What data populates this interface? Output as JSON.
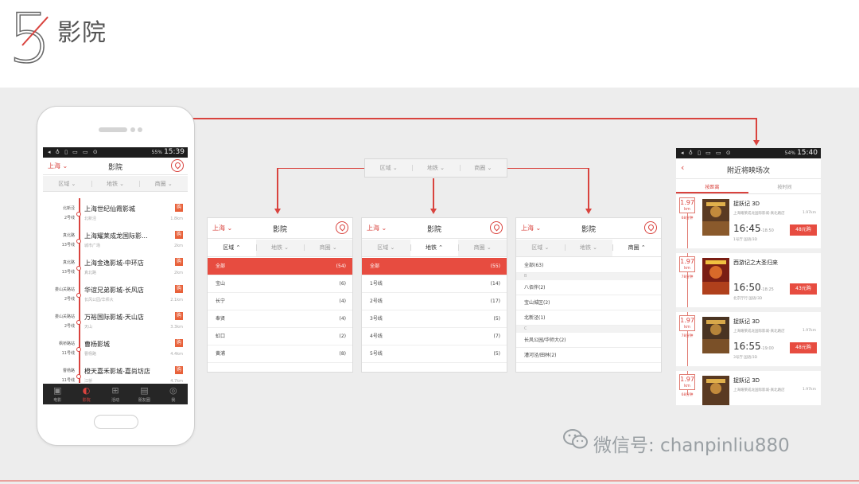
{
  "header": {
    "number": "5",
    "title": "影院"
  },
  "status": {
    "time1": "15:39",
    "batt1": "55%",
    "time2": "15:40",
    "batt2": "54%",
    "icons": "◂ ♁ ▯ ▭ ▭ ⊙"
  },
  "nav": {
    "city": "上海",
    "title": "影院",
    "title_shows": "附近将映场次"
  },
  "filters": {
    "area": "区域",
    "metro": "地铁",
    "district": "商圈"
  },
  "cinemas": [
    {
      "dist": "北新泾",
      "line": "2号线",
      "name": "上海世纪仙霞影城",
      "addr": "北新泾",
      "km": "1.8km"
    },
    {
      "dist": "真北路",
      "line": "13号线",
      "name": "上海耀莱成龙国际影...",
      "addr": "城市广场",
      "km": "2km"
    },
    {
      "dist": "真北路",
      "line": "13号线",
      "name": "上海金逸影城-中环店",
      "addr": "真北路",
      "km": "2km"
    },
    {
      "dist": "娄山关路站",
      "line": "2号线",
      "name": "华谊兄弟影城-长风店",
      "addr": "长风公园/华师大",
      "km": "2.1km"
    },
    {
      "dist": "娄山关路站",
      "line": "2号线",
      "name": "万裕国际影城-天山店",
      "addr": "长风公园/华师大",
      "km": "3.3km"
    },
    {
      "dist": "枫桥路站",
      "line": "11号线",
      "name": "曹杨影城",
      "addr": "天山",
      "km": "4.4km"
    },
    {
      "dist": "曹杨路",
      "line": "11号线",
      "name": "橙天嘉禾影城-嘉尚坊店",
      "addr": "曹杨路",
      "km": "4.5km"
    }
  ],
  "last_cinema_addr": "江桥",
  "last_cinema_km": "4.7km",
  "buy_label": "购",
  "tabs": [
    {
      "icon": "▣",
      "label": "电影"
    },
    {
      "icon": "◐",
      "label": "影院"
    },
    {
      "icon": "⊞",
      "label": "活动"
    },
    {
      "icon": "▤",
      "label": "朋友圈"
    },
    {
      "icon": "◎",
      "label": "我"
    }
  ],
  "area_list": [
    {
      "name": "全部",
      "count": "(54)"
    },
    {
      "name": "宝山",
      "count": "(6)"
    },
    {
      "name": "长宁",
      "count": "(4)"
    },
    {
      "name": "奉贤",
      "count": "(4)"
    },
    {
      "name": "虹口",
      "count": "(2)"
    },
    {
      "name": "黄浦",
      "count": "(8)"
    }
  ],
  "metro_list": [
    {
      "name": "全部",
      "count": "(55)"
    },
    {
      "name": "1号线",
      "count": "(14)"
    },
    {
      "name": "2号线",
      "count": "(17)"
    },
    {
      "name": "3号线",
      "count": "(5)"
    },
    {
      "name": "4号线",
      "count": "(7)"
    },
    {
      "name": "5号线",
      "count": "(5)"
    }
  ],
  "district_list": {
    "all": "全部(63)",
    "group_b": "B",
    "b1": "八佰伴(2)",
    "b2": "宝山城区(2)",
    "b3": "北新泾(1)",
    "group_c": "C",
    "c1": "长风公园/华师大(2)",
    "c2": "漕河泾/田林(2)"
  },
  "show_tabs": {
    "near": "按距离",
    "time": "按时间"
  },
  "shows": [
    {
      "km": "1.97",
      "unit": "km",
      "walk": "68分钟",
      "movie": "捉妖记 3D",
      "addr": "上海耀莱成龙国际影城-真北路店",
      "skm": "1.97km",
      "time": "16:45",
      "end": "-18:50",
      "hall": "1号厅   国语/3D",
      "price": "48元购"
    },
    {
      "km": "1.97",
      "unit": "km",
      "walk": "78分钟",
      "movie": "西游记之大圣归来",
      "addr": "",
      "skm": "",
      "time": "16:50",
      "end": "-18:25",
      "hall": "北京厅行   国语/3D",
      "price": "43元购"
    },
    {
      "km": "1.97",
      "unit": "km",
      "walk": "78分钟",
      "movie": "捉妖记 3D",
      "addr": "上海耀莱成龙国际影城-真北路店",
      "skm": "1.97km",
      "time": "16:55",
      "end": "-19:00",
      "hall": "3号厅   国语/3D",
      "price": "48元购"
    },
    {
      "km": "1.97",
      "unit": "km",
      "walk": "68分钟",
      "movie": "捉妖记 3D",
      "addr": "上海耀莱成龙国际影城-真北路店",
      "skm": "1.97km",
      "time": "",
      "end": "",
      "hall": "",
      "price": ""
    }
  ],
  "watermark": "微信号: chanpinliu880",
  "colors": {
    "accent": "#d9433e",
    "stage": "#ededed"
  }
}
